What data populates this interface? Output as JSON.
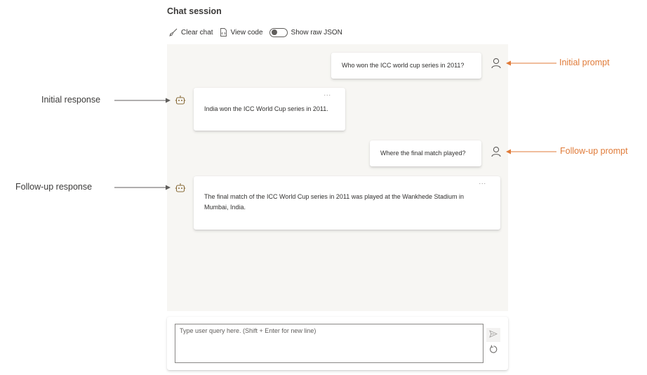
{
  "title": "Chat session",
  "toolbar": {
    "clear_label": "Clear chat",
    "view_code_label": "View code",
    "raw_json_label": "Show raw JSON",
    "raw_json_on": false
  },
  "messages": [
    {
      "role": "user",
      "text": "Who won the ICC world cup series in 2011?"
    },
    {
      "role": "assistant",
      "text": "India won the ICC World Cup series in 2011.",
      "more": "..."
    },
    {
      "role": "user",
      "text": "Where the final match played?"
    },
    {
      "role": "assistant",
      "text": "The final match of the ICC World Cup series in 2011 was played at the Wankhede Stadium in Mumbai, India.",
      "more": "..."
    }
  ],
  "annotations": {
    "initial_prompt": "Initial prompt",
    "initial_response": "Initial response",
    "followup_prompt": "Follow-up prompt",
    "followup_response": "Follow-up response"
  },
  "input": {
    "placeholder": "Type user query here. (Shift + Enter for new line)",
    "value": ""
  },
  "colors": {
    "annotation_accent": "#e07b39",
    "chat_background": "#f7f6f3"
  },
  "icons": [
    "broom-icon",
    "code-file-icon",
    "toggle-switch",
    "person-icon",
    "bot-icon",
    "send-icon",
    "reset-icon"
  ]
}
